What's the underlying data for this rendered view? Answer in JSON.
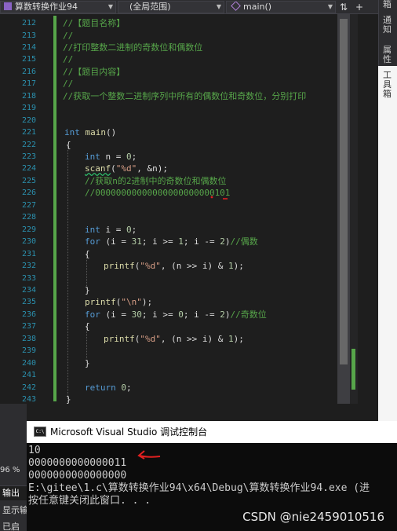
{
  "navbar": {
    "project": "算数转换作业94",
    "scope": "(全局范围)",
    "member": "main()",
    "nav_btn_glyph": "⇅",
    "add_btn_glyph": "+"
  },
  "rail": {
    "tab_top": "通知",
    "tab_props": "属性",
    "tab_toolbox": "工具箱",
    "tab_clipped": "箱"
  },
  "editor": {
    "line_numbers": [
      "212",
      "213",
      "214",
      "215",
      "216",
      "217",
      "218",
      "219",
      "220",
      "221",
      "222",
      "223",
      "224",
      "225",
      "226",
      "227",
      "228",
      "229",
      "230",
      "231",
      "232",
      "233",
      "234",
      "235",
      "236",
      "237",
      "238",
      "239",
      "240",
      "241",
      "242",
      "243"
    ],
    "lines": {
      "l212": "//【题目名称】",
      "l213": "//",
      "l214": "//打印整数二进制的奇数位和偶数位",
      "l215": "//",
      "l216": "//【题目内容】",
      "l217": "//",
      "l218": "//获取一个整数二进制序列中所有的偶数位和奇数位，分别打印",
      "l221_kw": "int",
      "l221_fn": "main",
      "l221_rest": "()",
      "brace_open": "{",
      "brace_close": "}",
      "l223_kw": "int",
      "l223_rest": " n = ",
      "l223_num": "0",
      "l223_end": ";",
      "l224_fn": "scanf",
      "l224_p1": "(",
      "l224_str": "\"%d\"",
      "l224_rest": ", &n);",
      "l225": "//获取n的2进制中的奇数位和偶数位",
      "l226": "//00000000000000000000000101",
      "l229_kw": "int",
      "l229_rest": " i = ",
      "l229_num": "0",
      "l229_end": ";",
      "l230_kw": "for",
      "l230_a": " (i = ",
      "l230_n1": "31",
      "l230_b": "; i >= ",
      "l230_n2": "1",
      "l230_c": "; i -= ",
      "l230_n3": "2",
      "l230_d": ")",
      "l230_cm": "//偶数",
      "l232_fn": "printf",
      "l232_p1": "(",
      "l232_str": "\"%d\"",
      "l232_rest": ", (n >> i) & ",
      "l232_num": "1",
      "l232_end": ");",
      "l235_fn": "printf",
      "l235_p1": "(",
      "l235_str": "\"\\n\"",
      "l235_end": ");",
      "l236_kw": "for",
      "l236_a": " (i = ",
      "l236_n1": "30",
      "l236_b": "; i >= ",
      "l236_n2": "0",
      "l236_c": "; i -= ",
      "l236_n3": "2",
      "l236_d": ")",
      "l236_cm": "//奇数位",
      "l238_fn": "printf",
      "l238_p1": "(",
      "l238_str": "\"%d\"",
      "l238_rest": ", (n >> i) & ",
      "l238_num": "1",
      "l238_end": ");",
      "l242_kw": "return",
      "l242_rest": " ",
      "l242_num": "0",
      "l242_end": ";"
    }
  },
  "console": {
    "icon_text": "C:\\",
    "title": "Microsoft Visual Studio 调试控制台",
    "lines": [
      "10",
      "0000000000000011",
      "0000000000000000",
      "E:\\gitee\\1.c\\算数转换作业94\\x64\\Debug\\算数转换作业94.exe (进",
      "按任意键关闭此窗口. . ."
    ]
  },
  "bottom_panel": {
    "zoom": "96 %",
    "tab_output": "输出",
    "tab_show": "显示输",
    "tab_misc": "已启"
  },
  "watermark": "CSDN @nie2459010516",
  "colors": {
    "comment": "#57a64a",
    "keyword": "#569cd6",
    "function": "#dcdcaa",
    "string": "#d69d85",
    "number": "#b5cea8",
    "line_number": "#2b91af",
    "annotation_arrow": "#e02020"
  }
}
